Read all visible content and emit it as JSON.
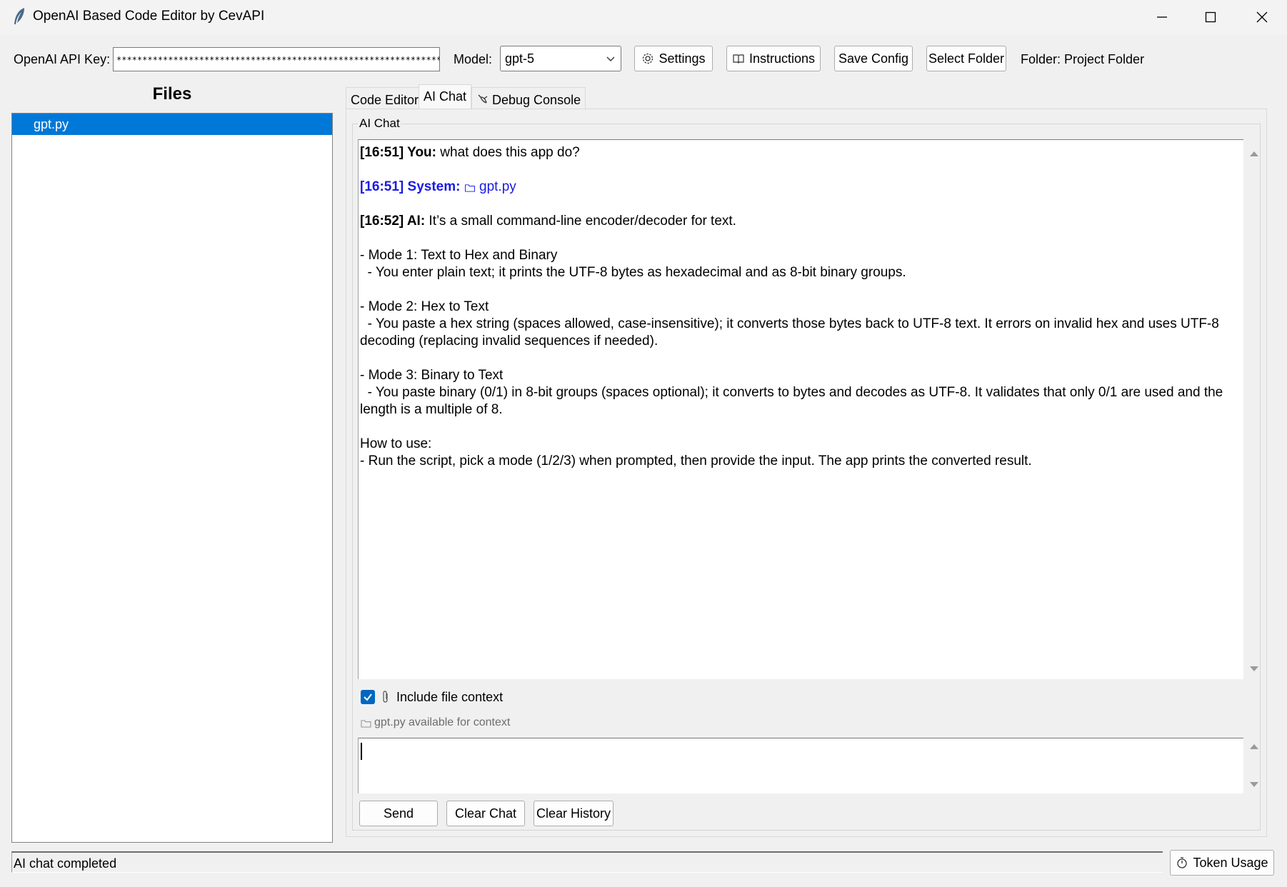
{
  "window": {
    "title": "OpenAI Based Code Editor by CevAPI",
    "icon": "feather-icon"
  },
  "toolbar": {
    "api_key_label": "OpenAI API Key:",
    "api_key_value": "******************************************************************",
    "model_label": "Model:",
    "model_value": "gpt-5",
    "settings_label": "Settings",
    "instructions_label": "Instructions",
    "save_config_label": "Save Config",
    "select_folder_label": "Select Folder",
    "folder_text": "Folder: Project Folder"
  },
  "files": {
    "title": "Files",
    "items": [
      "gpt.py"
    ]
  },
  "tabs": [
    {
      "label": "Code Editor"
    },
    {
      "label": "AI Chat"
    },
    {
      "label": "Debug Console"
    }
  ],
  "chat": {
    "group_label": "AI Chat",
    "messages": [
      {
        "prefix": "[16:51] You:",
        "text": " what does this app do?"
      },
      {
        "prefix": "[16:51]  System:",
        "text": "gpt.py"
      },
      {
        "prefix": "[16:52] AI:",
        "text": " It’s a small command-line encoder/decoder for text."
      }
    ],
    "body_lines": [
      "- Mode 1: Text to Hex and Binary",
      "  - You enter plain text; it prints the UTF-8 bytes as hexadecimal and as 8-bit binary groups.",
      "- Mode 2: Hex to Text",
      "  - You paste a hex string (spaces allowed, case-insensitive); it converts those bytes back to UTF-8 text. It errors on invalid hex and uses UTF-8 decoding (replacing invalid sequences if needed).",
      "- Mode 3: Binary to Text",
      "  - You paste binary (0/1) in 8-bit groups (spaces optional); it converts to bytes and decodes as UTF-8. It validates that only 0/1 are used and the length is a multiple of 8.",
      "How to use:",
      "- Run the script, pick a mode (1/2/3) when prompted, then provide the input. The app prints the converted result."
    ],
    "include_context_label": "Include file context",
    "include_context_checked": true,
    "context_note": "gpt.py available for context",
    "send_label": "Send",
    "clear_chat_label": "Clear Chat",
    "clear_history_label": "Clear History"
  },
  "status": {
    "text": "AI chat completed",
    "token_usage_label": "Token Usage"
  },
  "colors": {
    "accent": "#0078d7",
    "system_text": "#1a1ae6",
    "checkbox": "#0067c0"
  }
}
